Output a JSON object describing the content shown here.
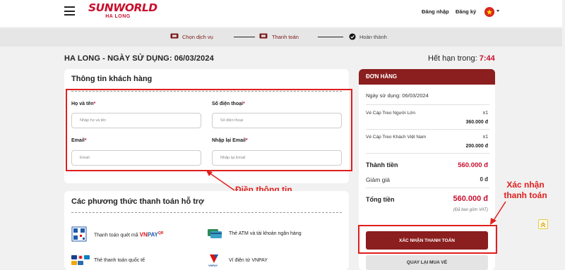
{
  "header": {
    "logo_brand": "SUNWORLD",
    "logo_sub": "HA LONG",
    "login": "Đăng nhập",
    "register": "Đăng ký",
    "language_icon": "vietnam-flag-icon"
  },
  "steps": [
    {
      "label": "Chọn dịch vụ",
      "icon": "ticket-icon"
    },
    {
      "label": "Thanh toán",
      "icon": "ticket-icon"
    },
    {
      "label": "Hoàn thành",
      "icon": "check-circle-icon"
    }
  ],
  "main": {
    "date_title": "HA LONG - NGÀY SỬ DỤNG: 06/03/2024",
    "timer_label": "Hết hạn trong:",
    "timer_value": "7:44"
  },
  "customer_info": {
    "title": "Thông tin khách hàng",
    "fields": {
      "name": {
        "label": "Họ và tên",
        "placeholder": "Nhập họ và tên"
      },
      "phone": {
        "label": "Số điện thoại",
        "placeholder": "Số điện thoại"
      },
      "email": {
        "label": "Email",
        "placeholder": "Email"
      },
      "email_confirm": {
        "label": "Nhập lại Email",
        "placeholder": "Nhập lại Email"
      }
    },
    "required_mark": "*"
  },
  "payment_methods": {
    "title": "Các phương thức thanh toán hỗ trợ",
    "items": [
      {
        "label": "Thanh toán quét mã",
        "brand_vn": "VN",
        "brand_pay": "PAY",
        "brand_qr": "QR",
        "icon": "qr-code-icon"
      },
      {
        "label": "Thẻ ATM và tài khoản ngân hàng",
        "icon": "bank-card-icon"
      },
      {
        "label": "Thẻ thanh toán quốc tế",
        "icon": "credit-card-icon"
      },
      {
        "label": "Ví điện tử VNPAY",
        "icon": "vnpay-wallet-icon"
      }
    ]
  },
  "order": {
    "title": "ĐƠN HÀNG",
    "date_line": "Ngày sử dụng: 06/03/2024",
    "items": [
      {
        "name": "Vé Cáp Treo Người Lớn",
        "qty": "x1",
        "price": "360.000 đ"
      },
      {
        "name": "Vé Cáp Treo Khách Việt Nam",
        "qty": "x1",
        "price": "200.000 đ"
      }
    ],
    "subtotal_label": "Thành tiền",
    "subtotal_value": "560.000 đ",
    "discount_label": "Giảm giá",
    "discount_value": "0 đ",
    "total_label": "Tổng tiền",
    "total_value": "560.000 đ",
    "vat_note": "(Đã bao gồm VAT)",
    "confirm_button": "XÁC NHẬN THANH TOÁN",
    "back_button": "QUAY LẠI MUA VÉ"
  },
  "annotations": {
    "fill_info": "Điền thông tin",
    "confirm_payment_line1": "Xác nhận",
    "confirm_payment_line2": "thanh toán"
  },
  "colors": {
    "brand_red": "#c8102e",
    "dark_red": "#8b1e1e",
    "annotation_red": "#e01e1e"
  }
}
